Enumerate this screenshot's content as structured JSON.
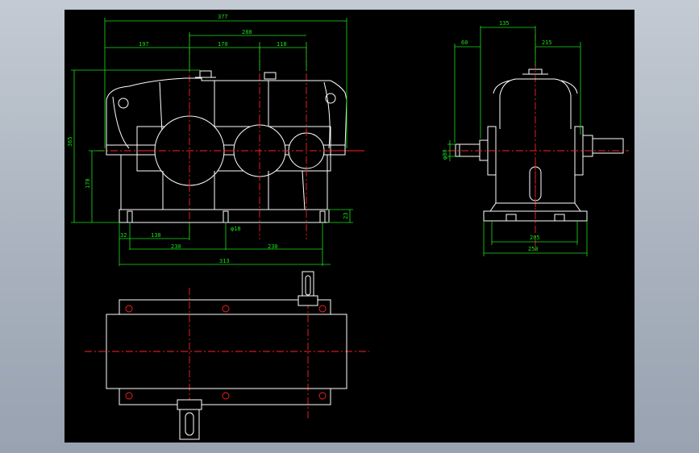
{
  "colors": {
    "background_outer": "#b4bcc7",
    "drawing_background": "#000000",
    "outline": "#ffffff",
    "dimension": "#19e019",
    "center_line": "#ff2020"
  },
  "front_view": {
    "dims": {
      "overall_length": "377",
      "left_offset": "197",
      "center_distance_total": "288",
      "center_distance_1": "170",
      "center_distance_2": "118",
      "overall_height": "365",
      "shaft_height": "170",
      "base_thickness": "23",
      "edge_offset": "32",
      "first_bolt_offset": "138",
      "bolt_hole": "φ18",
      "bolt_pitch_1": "230",
      "bolt_pitch_2": "230",
      "base_length": "313"
    }
  },
  "side_view": {
    "dims": {
      "top_width": "135",
      "left_offset": "60",
      "half_width": "215",
      "shaft_diameter": "φ80",
      "base_inner": "205",
      "base_outer": "250"
    }
  }
}
